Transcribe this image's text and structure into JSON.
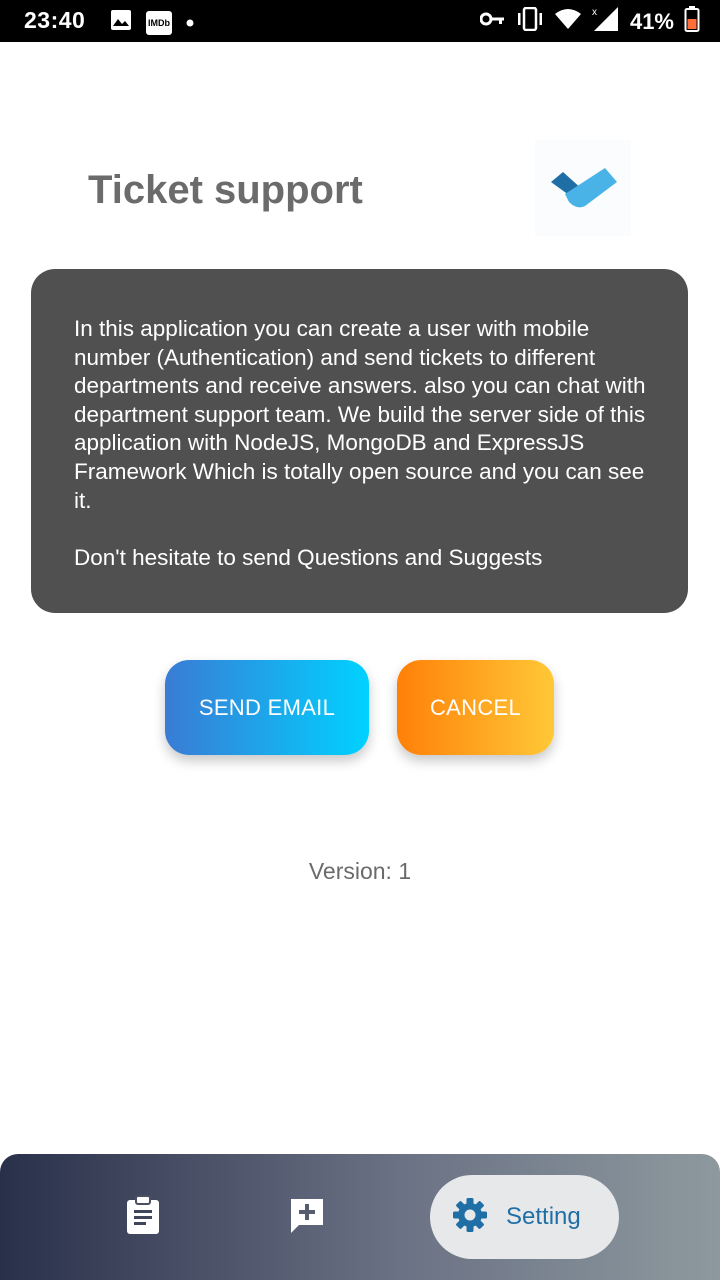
{
  "status_bar": {
    "time": "23:40",
    "imdb": "IMDb",
    "battery": "41%",
    "icons": [
      "image-icon",
      "imdb-icon",
      "dot-icon",
      "vpn-key-icon",
      "vibrate-icon",
      "wifi-icon",
      "signal-icon",
      "battery-icon"
    ]
  },
  "header": {
    "title": "Ticket support",
    "logo": "app-logo-icon"
  },
  "info_card": {
    "text": "In this application you can create a user with mobile number (Authentication) and send tickets to different departments and receive answers. also you can chat with department support team. We build the server side of this application with NodeJS, MongoDB and ExpressJS Framework Which is totally open source and you can see it.",
    "note": "Don't hesitate to send Questions and Suggests"
  },
  "buttons": {
    "send_email": "SEND EMAIL",
    "cancel": "CANCEL"
  },
  "version": "Version: 1",
  "bottom_nav": {
    "items": [
      {
        "icon": "clipboard-icon",
        "label": ""
      },
      {
        "icon": "add-comment-icon",
        "label": ""
      },
      {
        "icon": "gear-icon",
        "label": "Setting",
        "selected": true
      }
    ]
  },
  "colors": {
    "card_bg": "#505050",
    "title_text": "#6b6b6b",
    "send_gradient": [
      "#3a7bd5",
      "#00d2ff"
    ],
    "cancel_gradient": [
      "#ff8008",
      "#ffc837"
    ],
    "nav_gradient": [
      "#29304a",
      "#8d999e"
    ],
    "setting_accent": "#1f6fa6"
  }
}
